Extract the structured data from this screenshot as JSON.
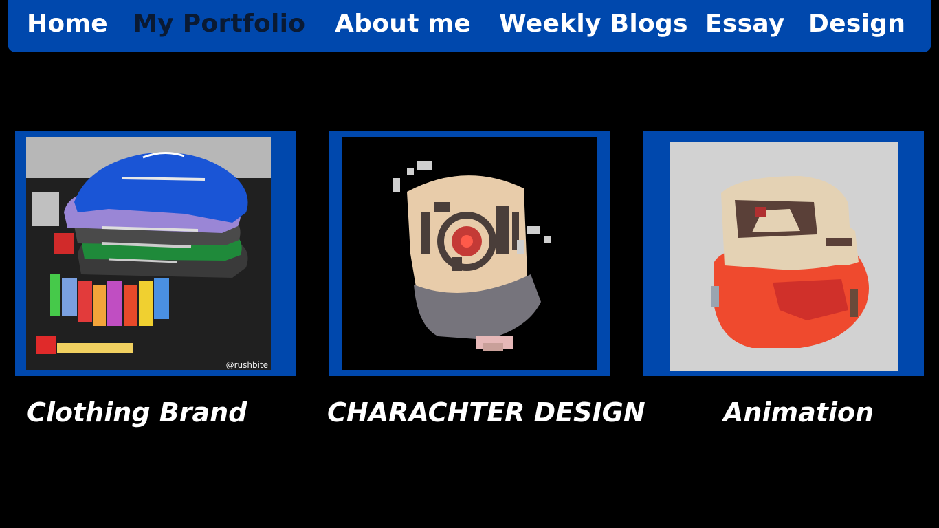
{
  "nav": {
    "items": [
      {
        "label": "Home"
      },
      {
        "label": "My Portfolio",
        "active": true
      },
      {
        "label": "About me"
      },
      {
        "label": "Weekly Blogs"
      },
      {
        "label": "Essay"
      },
      {
        "label": "Design"
      }
    ]
  },
  "cards": [
    {
      "caption": "Clothing Brand",
      "image_watermark": "@rushbite"
    },
    {
      "caption": "CHARACHTER DESIGN"
    },
    {
      "caption": "Animation"
    }
  ],
  "colors": {
    "background": "#000000",
    "nav_bg": "#0048ad",
    "frame": "#0048ad",
    "nav_text": "#ffffff",
    "nav_active_text": "#0a1a33"
  }
}
